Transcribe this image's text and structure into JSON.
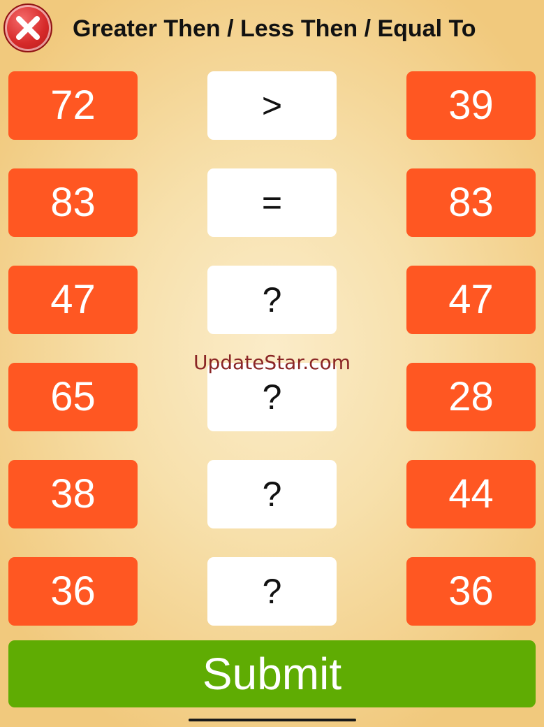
{
  "header": {
    "title": "Greater Then / Less Then / Equal To",
    "close_icon": "close-icon"
  },
  "rows": [
    {
      "left": "72",
      "operator": ">",
      "right": "39"
    },
    {
      "left": "83",
      "operator": "=",
      "right": "83"
    },
    {
      "left": "47",
      "operator": "?",
      "right": "47"
    },
    {
      "left": "65",
      "operator": "?",
      "right": "28"
    },
    {
      "left": "38",
      "operator": "?",
      "right": "44"
    },
    {
      "left": "36",
      "operator": "?",
      "right": "36"
    }
  ],
  "watermark": "UpdateStar.com",
  "submit_label": "Submit",
  "colors": {
    "number_box": "#ff5722",
    "operator_box": "#ffffff",
    "submit": "#5fac03",
    "close": "#d62a2a",
    "watermark": "#8a2525"
  }
}
